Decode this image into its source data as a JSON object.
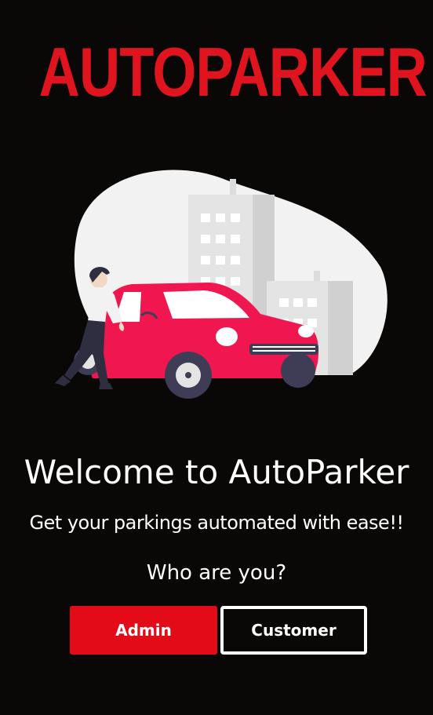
{
  "brand": {
    "logo_text": "AUTOPARKER",
    "accent_color": "#e0141e"
  },
  "hero": {
    "illustration": "woman-walking-to-red-car-city-buildings"
  },
  "welcome": {
    "title": "Welcome to AutoParker",
    "subtitle": "Get your parkings automated with ease!!"
  },
  "role_prompt": {
    "question": "Who are you?",
    "admin_label": "Admin",
    "customer_label": "Customer"
  },
  "colors": {
    "background": "#0a0806",
    "admin_button": "#e30b17",
    "car_body": "#f0164f"
  }
}
